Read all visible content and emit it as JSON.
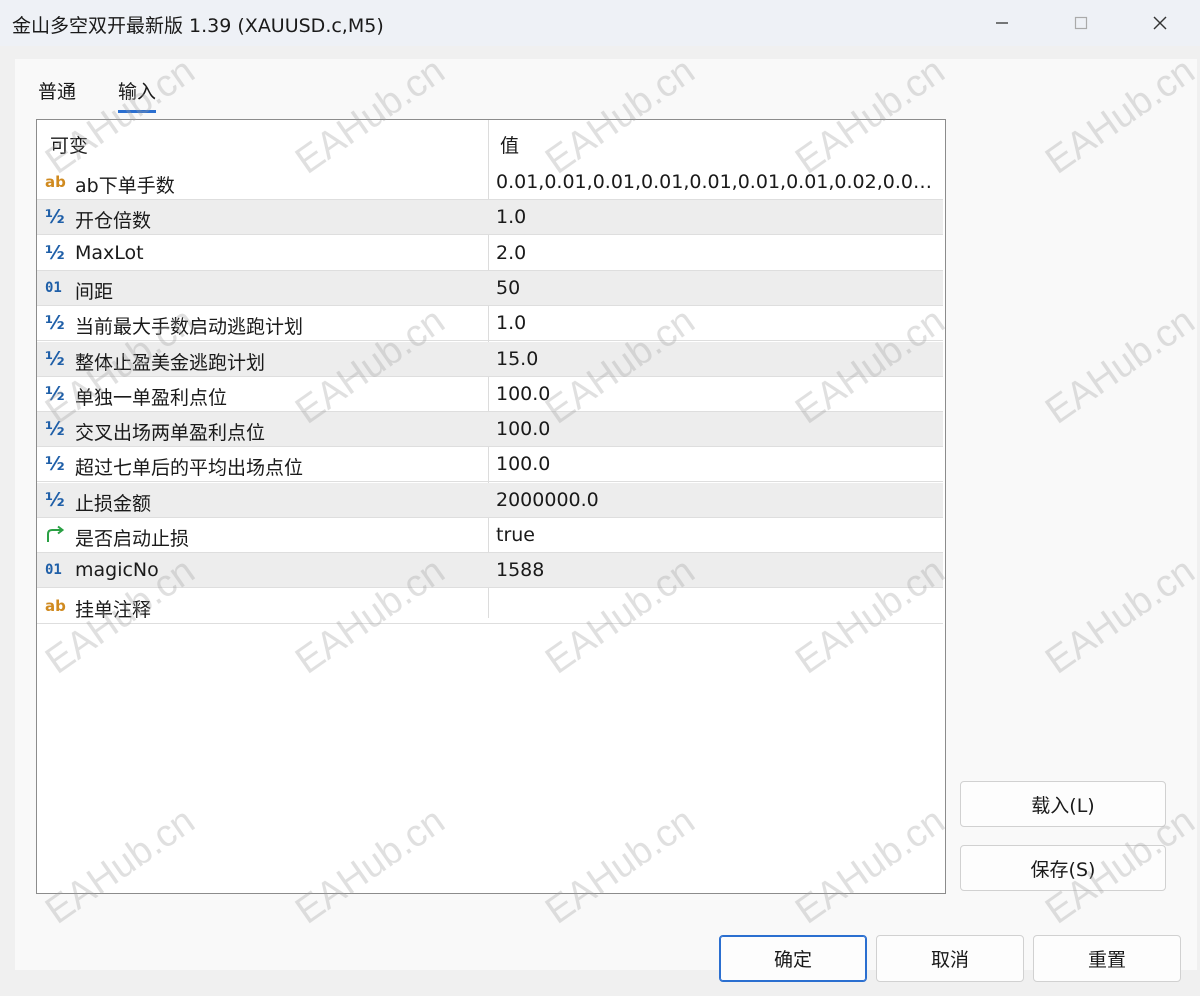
{
  "window": {
    "title": "金山多空双开最新版 1.39 (XAUUSD.c,M5)"
  },
  "tabs": [
    {
      "label": "普通"
    },
    {
      "label": "输入"
    }
  ],
  "grid": {
    "header_name": "可变",
    "header_value": "值",
    "rows": [
      {
        "icon": "ab",
        "name": "ab下单手数",
        "value": "0.01,0.01,0.01,0.01,0.01,0.01,0.01,0.02,0.02,0...."
      },
      {
        "icon": "½",
        "name": "开仓倍数",
        "value": "1.0"
      },
      {
        "icon": "½",
        "name": "MaxLot",
        "value": "2.0"
      },
      {
        "icon": "01",
        "name": "间距",
        "value": "50"
      },
      {
        "icon": "½",
        "name": "当前最大手数启动逃跑计划",
        "value": "1.0"
      },
      {
        "icon": "½",
        "name": "整体止盈美金逃跑计划",
        "value": "15.0"
      },
      {
        "icon": "½",
        "name": "单独一单盈利点位",
        "value": "100.0"
      },
      {
        "icon": "½",
        "name": "交叉出场两单盈利点位",
        "value": "100.0"
      },
      {
        "icon": "½",
        "name": "超过七单后的平均出场点位",
        "value": "100.0"
      },
      {
        "icon": "½",
        "name": "止损金额",
        "value": "2000000.0"
      },
      {
        "icon": "bool",
        "name": "是否启动止损",
        "value": "true"
      },
      {
        "icon": "01",
        "name": "magicNo",
        "value": "1588"
      },
      {
        "icon": "ab",
        "name": "挂单注释",
        "value": ""
      }
    ]
  },
  "side_buttons": {
    "load": "载入(L)",
    "save": "保存(S)"
  },
  "footer_buttons": {
    "ok": "确定",
    "cancel": "取消",
    "reset": "重置"
  },
  "watermark": {
    "text": "EAHub.cn"
  }
}
